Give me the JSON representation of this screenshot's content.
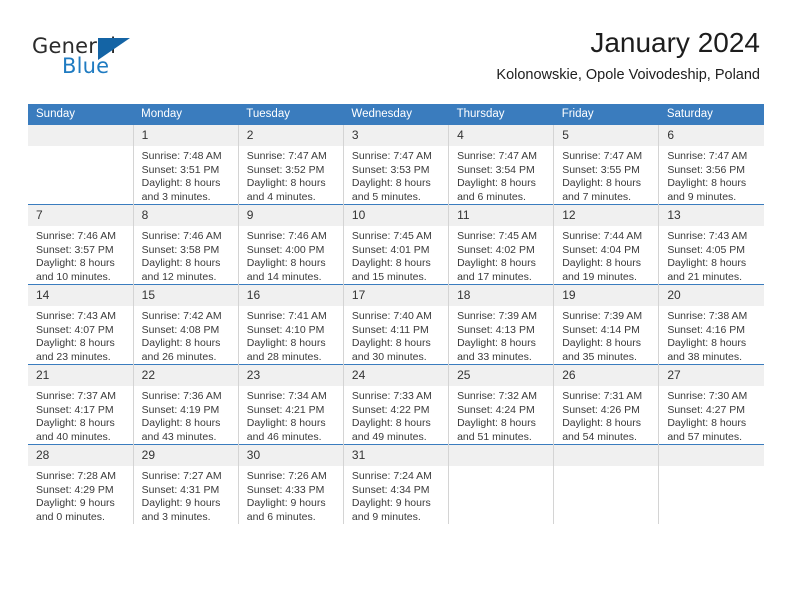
{
  "brand": {
    "name_part1": "General",
    "name_part2": "Blue",
    "accent_color": "#1f7bc1",
    "triangle_color": "#1464a5"
  },
  "header": {
    "title": "January 2024",
    "subtitle": "Kolonowskie, Opole Voivodeship, Poland"
  },
  "calendar": {
    "header_bg": "#3a7cbe",
    "daynum_bg": "#f0f0f0",
    "weekday_headers": [
      "Sunday",
      "Monday",
      "Tuesday",
      "Wednesday",
      "Thursday",
      "Friday",
      "Saturday"
    ],
    "weeks": [
      [
        {
          "day": "",
          "sunrise": "",
          "sunset": "",
          "daylight1": "",
          "daylight2": ""
        },
        {
          "day": "1",
          "sunrise": "Sunrise: 7:48 AM",
          "sunset": "Sunset: 3:51 PM",
          "daylight1": "Daylight: 8 hours",
          "daylight2": "and 3 minutes."
        },
        {
          "day": "2",
          "sunrise": "Sunrise: 7:47 AM",
          "sunset": "Sunset: 3:52 PM",
          "daylight1": "Daylight: 8 hours",
          "daylight2": "and 4 minutes."
        },
        {
          "day": "3",
          "sunrise": "Sunrise: 7:47 AM",
          "sunset": "Sunset: 3:53 PM",
          "daylight1": "Daylight: 8 hours",
          "daylight2": "and 5 minutes."
        },
        {
          "day": "4",
          "sunrise": "Sunrise: 7:47 AM",
          "sunset": "Sunset: 3:54 PM",
          "daylight1": "Daylight: 8 hours",
          "daylight2": "and 6 minutes."
        },
        {
          "day": "5",
          "sunrise": "Sunrise: 7:47 AM",
          "sunset": "Sunset: 3:55 PM",
          "daylight1": "Daylight: 8 hours",
          "daylight2": "and 7 minutes."
        },
        {
          "day": "6",
          "sunrise": "Sunrise: 7:47 AM",
          "sunset": "Sunset: 3:56 PM",
          "daylight1": "Daylight: 8 hours",
          "daylight2": "and 9 minutes."
        }
      ],
      [
        {
          "day": "7",
          "sunrise": "Sunrise: 7:46 AM",
          "sunset": "Sunset: 3:57 PM",
          "daylight1": "Daylight: 8 hours",
          "daylight2": "and 10 minutes."
        },
        {
          "day": "8",
          "sunrise": "Sunrise: 7:46 AM",
          "sunset": "Sunset: 3:58 PM",
          "daylight1": "Daylight: 8 hours",
          "daylight2": "and 12 minutes."
        },
        {
          "day": "9",
          "sunrise": "Sunrise: 7:46 AM",
          "sunset": "Sunset: 4:00 PM",
          "daylight1": "Daylight: 8 hours",
          "daylight2": "and 14 minutes."
        },
        {
          "day": "10",
          "sunrise": "Sunrise: 7:45 AM",
          "sunset": "Sunset: 4:01 PM",
          "daylight1": "Daylight: 8 hours",
          "daylight2": "and 15 minutes."
        },
        {
          "day": "11",
          "sunrise": "Sunrise: 7:45 AM",
          "sunset": "Sunset: 4:02 PM",
          "daylight1": "Daylight: 8 hours",
          "daylight2": "and 17 minutes."
        },
        {
          "day": "12",
          "sunrise": "Sunrise: 7:44 AM",
          "sunset": "Sunset: 4:04 PM",
          "daylight1": "Daylight: 8 hours",
          "daylight2": "and 19 minutes."
        },
        {
          "day": "13",
          "sunrise": "Sunrise: 7:43 AM",
          "sunset": "Sunset: 4:05 PM",
          "daylight1": "Daylight: 8 hours",
          "daylight2": "and 21 minutes."
        }
      ],
      [
        {
          "day": "14",
          "sunrise": "Sunrise: 7:43 AM",
          "sunset": "Sunset: 4:07 PM",
          "daylight1": "Daylight: 8 hours",
          "daylight2": "and 23 minutes."
        },
        {
          "day": "15",
          "sunrise": "Sunrise: 7:42 AM",
          "sunset": "Sunset: 4:08 PM",
          "daylight1": "Daylight: 8 hours",
          "daylight2": "and 26 minutes."
        },
        {
          "day": "16",
          "sunrise": "Sunrise: 7:41 AM",
          "sunset": "Sunset: 4:10 PM",
          "daylight1": "Daylight: 8 hours",
          "daylight2": "and 28 minutes."
        },
        {
          "day": "17",
          "sunrise": "Sunrise: 7:40 AM",
          "sunset": "Sunset: 4:11 PM",
          "daylight1": "Daylight: 8 hours",
          "daylight2": "and 30 minutes."
        },
        {
          "day": "18",
          "sunrise": "Sunrise: 7:39 AM",
          "sunset": "Sunset: 4:13 PM",
          "daylight1": "Daylight: 8 hours",
          "daylight2": "and 33 minutes."
        },
        {
          "day": "19",
          "sunrise": "Sunrise: 7:39 AM",
          "sunset": "Sunset: 4:14 PM",
          "daylight1": "Daylight: 8 hours",
          "daylight2": "and 35 minutes."
        },
        {
          "day": "20",
          "sunrise": "Sunrise: 7:38 AM",
          "sunset": "Sunset: 4:16 PM",
          "daylight1": "Daylight: 8 hours",
          "daylight2": "and 38 minutes."
        }
      ],
      [
        {
          "day": "21",
          "sunrise": "Sunrise: 7:37 AM",
          "sunset": "Sunset: 4:17 PM",
          "daylight1": "Daylight: 8 hours",
          "daylight2": "and 40 minutes."
        },
        {
          "day": "22",
          "sunrise": "Sunrise: 7:36 AM",
          "sunset": "Sunset: 4:19 PM",
          "daylight1": "Daylight: 8 hours",
          "daylight2": "and 43 minutes."
        },
        {
          "day": "23",
          "sunrise": "Sunrise: 7:34 AM",
          "sunset": "Sunset: 4:21 PM",
          "daylight1": "Daylight: 8 hours",
          "daylight2": "and 46 minutes."
        },
        {
          "day": "24",
          "sunrise": "Sunrise: 7:33 AM",
          "sunset": "Sunset: 4:22 PM",
          "daylight1": "Daylight: 8 hours",
          "daylight2": "and 49 minutes."
        },
        {
          "day": "25",
          "sunrise": "Sunrise: 7:32 AM",
          "sunset": "Sunset: 4:24 PM",
          "daylight1": "Daylight: 8 hours",
          "daylight2": "and 51 minutes."
        },
        {
          "day": "26",
          "sunrise": "Sunrise: 7:31 AM",
          "sunset": "Sunset: 4:26 PM",
          "daylight1": "Daylight: 8 hours",
          "daylight2": "and 54 minutes."
        },
        {
          "day": "27",
          "sunrise": "Sunrise: 7:30 AM",
          "sunset": "Sunset: 4:27 PM",
          "daylight1": "Daylight: 8 hours",
          "daylight2": "and 57 minutes."
        }
      ],
      [
        {
          "day": "28",
          "sunrise": "Sunrise: 7:28 AM",
          "sunset": "Sunset: 4:29 PM",
          "daylight1": "Daylight: 9 hours",
          "daylight2": "and 0 minutes."
        },
        {
          "day": "29",
          "sunrise": "Sunrise: 7:27 AM",
          "sunset": "Sunset: 4:31 PM",
          "daylight1": "Daylight: 9 hours",
          "daylight2": "and 3 minutes."
        },
        {
          "day": "30",
          "sunrise": "Sunrise: 7:26 AM",
          "sunset": "Sunset: 4:33 PM",
          "daylight1": "Daylight: 9 hours",
          "daylight2": "and 6 minutes."
        },
        {
          "day": "31",
          "sunrise": "Sunrise: 7:24 AM",
          "sunset": "Sunset: 4:34 PM",
          "daylight1": "Daylight: 9 hours",
          "daylight2": "and 9 minutes."
        },
        {
          "day": "",
          "sunrise": "",
          "sunset": "",
          "daylight1": "",
          "daylight2": ""
        },
        {
          "day": "",
          "sunrise": "",
          "sunset": "",
          "daylight1": "",
          "daylight2": ""
        },
        {
          "day": "",
          "sunrise": "",
          "sunset": "",
          "daylight1": "",
          "daylight2": ""
        }
      ]
    ]
  }
}
